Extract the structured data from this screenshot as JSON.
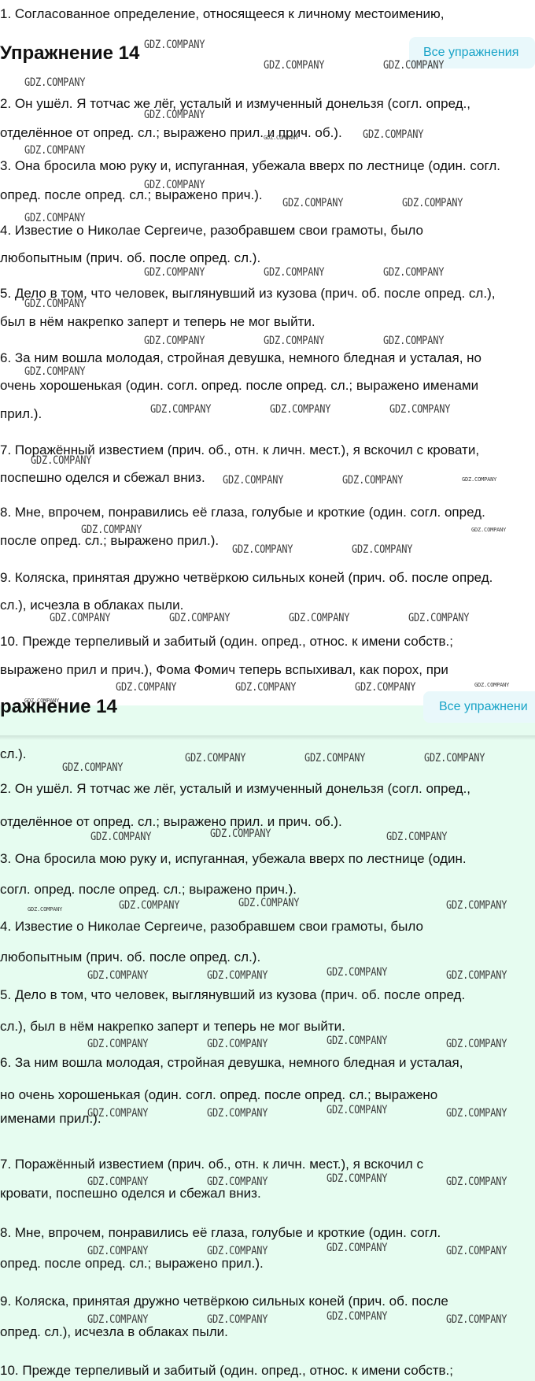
{
  "header": {
    "title": "Упражнение 14",
    "all_exercises_label": "Все упражнения",
    "title_cropped": "ражнение 14",
    "all_exercises_label_cropped": "Все упражнени"
  },
  "watermark": "GDZ.COMPANY",
  "top_lines": [
    "1. Согласованное определение, относящееся к личному местоимению,",
    "2. Он ушёл. Я тотчас же лёг, усталый и измученный донельзя (согл. опред.,",
    "отделённое от опред. сл.; выражено прил. и прич. об.).",
    "3. Она бросила мою руку и, испуганная, убежала вверх по лестнице (один. согл.",
    "опред. после опред. сл.; выражено прич.).",
    "4. Известие о Николае Сергеиче, разобравшем свои грамоты, было",
    "любопытным (прич. об. после опред. сл.).",
    "5. Дело в том, что человек, выглянувший из кузова (прич. об. после опред. сл.),",
    "был в нём накрепко заперт и теперь не мог выйти.",
    "6. За ним вошла молодая, стройная девушка, немного бледная и усталая, но",
    "очень хорошенькая (один. согл. опред. после опред. сл.; выражено именами",
    "прил.).",
    "7. Поражённый известием (прич. об., отн. к личн. мест.), я вскочил с кровати,",
    "поспешно оделся и сбежал вниз.",
    "8. Мне, впрочем, понравились её глаза, голубые и кроткие (один. согл. опред.",
    "после опред. сл.; выражено прил.).",
    "9. Коляска, принятая дружно четвёркою сильных коней (прич. об. после опред.",
    "сл.), исчезла в облаках пыли.",
    "10. Прежде терпеливый и забитый (один. опред., относ. к имени собств.;",
    "выражено прил и прич.), Фома Фомич теперь вспыхивал, как порох, при"
  ],
  "bottom_lines": [
    "сл.).",
    "2. Он ушёл. Я тотчас же лёг, усталый и измученный донельзя (согл. опред.,",
    "отделённое от опред. сл.; выражено прил. и прич. об.).",
    "3. Она бросила мою руку и, испуганная, убежала вверх по лестнице (один.",
    "согл. опред. после опред. сл.; выражено прич.).",
    "4. Известие о Николае Сергеиче, разобравшем свои грамоты, было",
    "любопытным (прич. об. после опред. сл.).",
    "5. Дело в том, что человек, выглянувший из кузова (прич. об. после опред.",
    "сл.), был в нём накрепко заперт и теперь не мог выйти.",
    "6. За ним вошла молодая, стройная девушка, немного бледная и усталая,",
    "но очень хорошенькая (один. согл. опред. после опред. сл.; выражено",
    "именами прил.).",
    "7. Поражённый известием (прич. об., отн. к личн. мест.), я вскочил с",
    "кровати, поспешно оделся и сбежал вниз.",
    "8. Мне, впрочем, понравились её глаза, голубые и кроткие (один. согл.",
    "опред. после опред. сл.; выражено прил.).",
    "9. Коляска, принятая дружно четвёркою сильных коней (прич. об. после",
    "опред. сл.), исчезла в облаках пыли.",
    "10. Прежде терпеливый и забитый (один. опред., относ. к имени собств.;"
  ]
}
